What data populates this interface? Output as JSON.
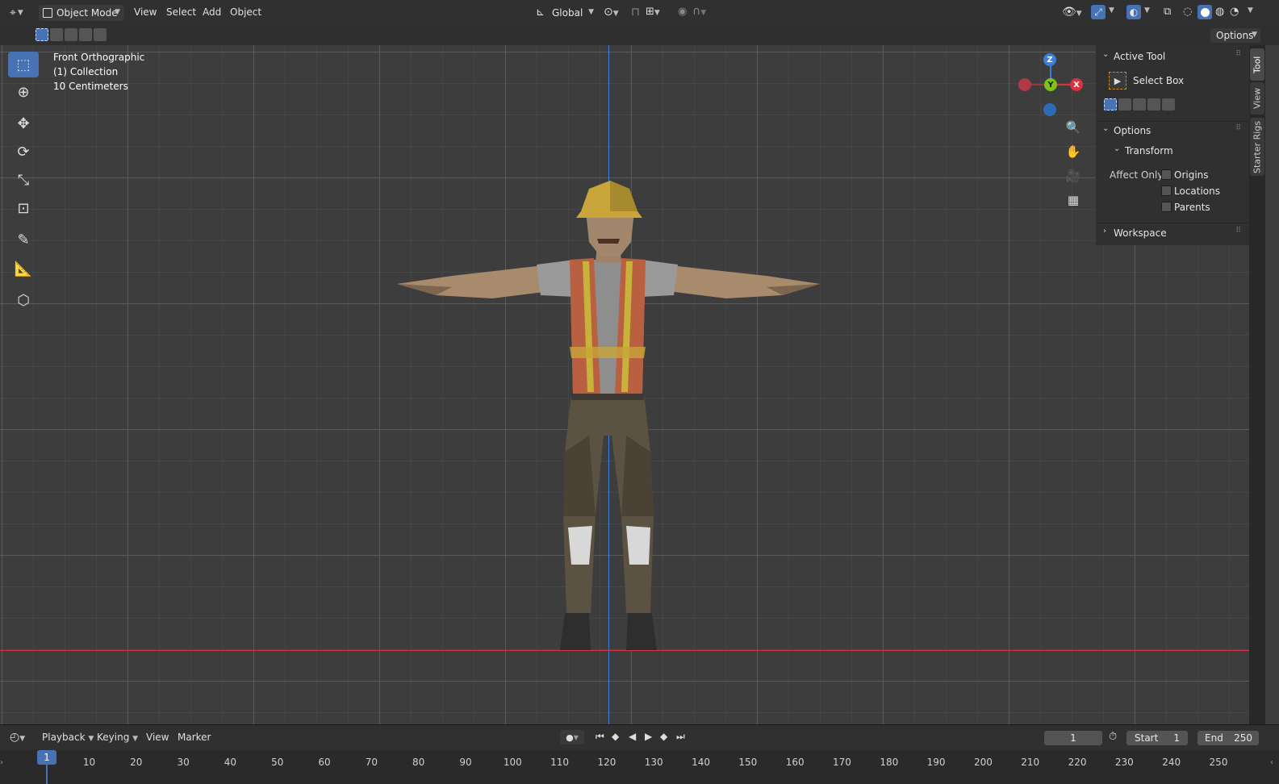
{
  "header": {
    "mode": "Object Mode",
    "menus": [
      "View",
      "Select",
      "Add",
      "Object"
    ],
    "transform_orientation": "Global"
  },
  "subheader": {
    "options_label": "Options"
  },
  "overlay": {
    "view_name": "Front Orthographic",
    "collection": "(1) Collection",
    "scale": "10 Centimeters"
  },
  "gizmo": {
    "z": "Z",
    "y": "Y",
    "x": "X"
  },
  "npanel": {
    "active_tool_title": "Active Tool",
    "tool_name": "Select Box",
    "options_title": "Options",
    "transform_title": "Transform",
    "affect_only_label": "Affect Only",
    "affect_items": [
      "Origins",
      "Locations",
      "Parents"
    ],
    "workspace_title": "Workspace"
  },
  "side_tabs": [
    "Tool",
    "View",
    "Starter Rigs"
  ],
  "timeline": {
    "menus": [
      "Playback",
      "Keying",
      "View",
      "Marker"
    ],
    "current_frame": "1",
    "start_label": "Start",
    "start_value": "1",
    "end_label": "End",
    "end_value": "250"
  },
  "ruler": {
    "current": "1",
    "ticks": [
      "10",
      "20",
      "30",
      "40",
      "50",
      "60",
      "70",
      "80",
      "90",
      "100",
      "110",
      "120",
      "130",
      "140",
      "150",
      "160",
      "170",
      "180",
      "190",
      "200",
      "210",
      "220",
      "230",
      "240",
      "250"
    ]
  },
  "colors": {
    "accent": "#4772b3",
    "axis_x": "#d8343f",
    "axis_y": "#7ac51b",
    "axis_z": "#3b7fd6"
  }
}
